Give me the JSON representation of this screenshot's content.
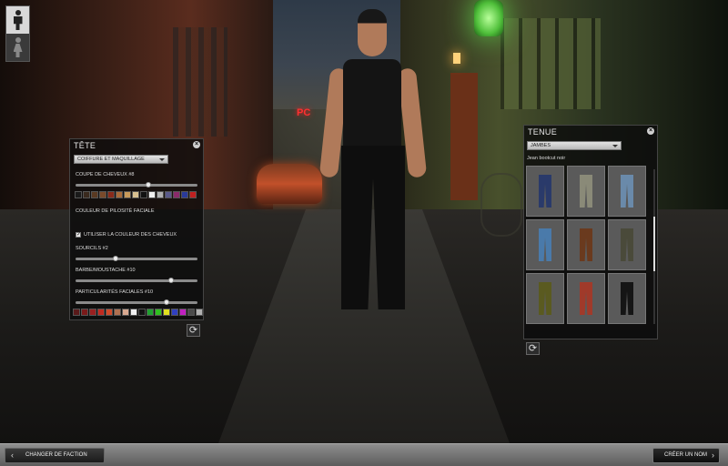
{
  "gender": {
    "male_icon": "male-figure-icon",
    "female_icon": "female-figure-icon",
    "selected": "male"
  },
  "scene": {
    "sign_text": "PC"
  },
  "tete": {
    "title": "TÊTE",
    "category_dropdown": "COIFFURE ET MAQUILLAGE",
    "hair_label": "COUPE DE CHEVEUX #8",
    "hair_slider": 0.6,
    "hair_colors": [
      "#1a1a1a",
      "#3a2a1e",
      "#5a3a22",
      "#7a4a2a",
      "#8a2a1a",
      "#a86a3a",
      "#c89a5a",
      "#d8c090",
      "#111111",
      "#f0f0f0",
      "#b0b0b0",
      "#5a5a8a",
      "#8a2a6a",
      "#2a3a9a",
      "#c02020"
    ],
    "facial_hair_label": "COULEUR DE PILOSITÉ FACIALE",
    "use_hair_color_label": "UTILISER LA COULEUR DES CHEVEUX",
    "use_hair_color_checked": true,
    "eyebrows_label": "SOURCILS #2",
    "eyebrows_slider": 0.32,
    "beard_label": "BARBE/MOUSTACHE #10",
    "beard_slider": 0.8,
    "facial_features_label": "PARTICULARITÉS FACIALES #10",
    "facial_features_slider": 0.76,
    "feature_colors": [
      "#5a1a1a",
      "#7a1a1a",
      "#9a2020",
      "#c02a20",
      "#d04a2a",
      "#b07050",
      "#d8a890",
      "#f0f0f0",
      "#111111",
      "#20a030",
      "#30c020",
      "#e0e020",
      "#3040c0",
      "#c020c0",
      "#4a4a4a",
      "#b0b0b0"
    ]
  },
  "tenue": {
    "title": "TENUE",
    "category_dropdown": "JAMBES",
    "selected_item": "Jean bootcut noir",
    "items": [
      {
        "color": "#2a3a6a"
      },
      {
        "color": "#8a8a78"
      },
      {
        "color": "#6a8aaa"
      },
      {
        "color": "#4a7aaa"
      },
      {
        "color": "#6a3a1e"
      },
      {
        "color": "#4a4a3a"
      },
      {
        "color": "#5a5a20"
      },
      {
        "color": "#a03a2a"
      },
      {
        "color": "#151515"
      }
    ]
  },
  "footer": {
    "change_faction_label": "CHANGER DE FACTION",
    "create_name_label": "CRÉER UN NOM"
  }
}
